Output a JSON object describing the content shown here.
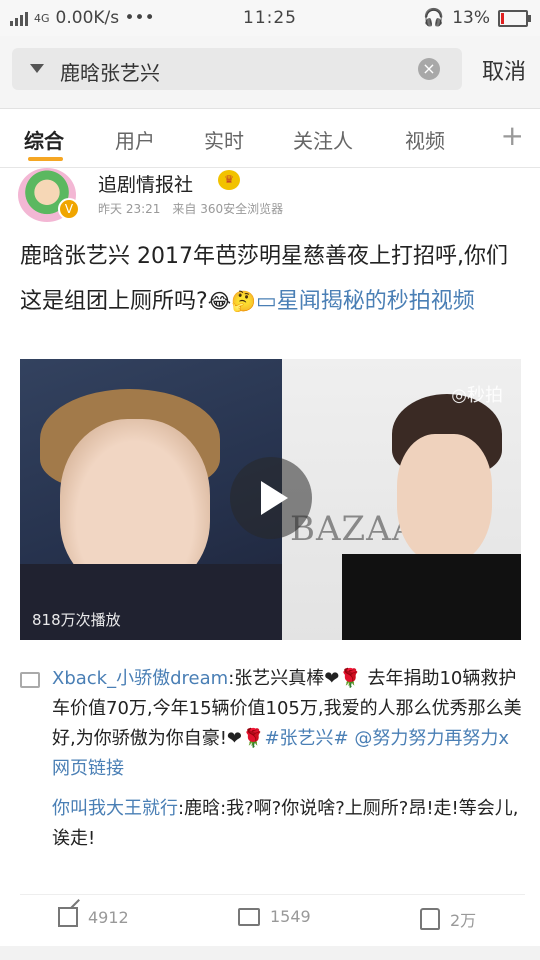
{
  "status_bar": {
    "network": "4G",
    "speed": "0.00K/s •••",
    "time": "11:25",
    "battery": "13%",
    "battery_level": 0.13
  },
  "search": {
    "query": "鹿晗张艺兴",
    "cancel_label": "取消"
  },
  "tabs": [
    "综合",
    "用户",
    "实时",
    "关注人",
    "视频"
  ],
  "active_tab_index": 0,
  "post": {
    "author": "追剧情报社",
    "time": "昨天 23:21",
    "source": "来自 360安全浏览器",
    "text_main": "鹿晗张艺兴 2017年芭莎明星慈善夜上打招呼,你们这是组团上厕所吗?",
    "emoji": "😂🤔",
    "link_icon": "▭",
    "link_text": "星闻揭秘的秒拍视频",
    "video": {
      "watermark": "◎秒拍",
      "play_count": "818万次播放",
      "bazaar_text": "BAZAAR"
    },
    "comments": [
      {
        "name": "Xback_小骄傲dream",
        "text": ":张艺兴真棒❤🌹   去年捐助10辆救护车价值70万,今年15辆价值105万,我爱的人那么优秀那么美好,为你骄傲为你自豪!❤🌹",
        "link": "#张艺兴# @努力努力再努力x 网页链接"
      },
      {
        "name": "你叫我大王就行",
        "text": ":鹿晗:我?啊?你说啥?上厕所?昂!走!等会儿,诶走!",
        "link": ""
      }
    ],
    "actions": {
      "share_count": "4912",
      "comment_count": "1549",
      "like_count": "2万"
    }
  },
  "colors": {
    "accent": "#f5a623",
    "link": "#4a7fb5",
    "battery_low": "#e02020"
  }
}
